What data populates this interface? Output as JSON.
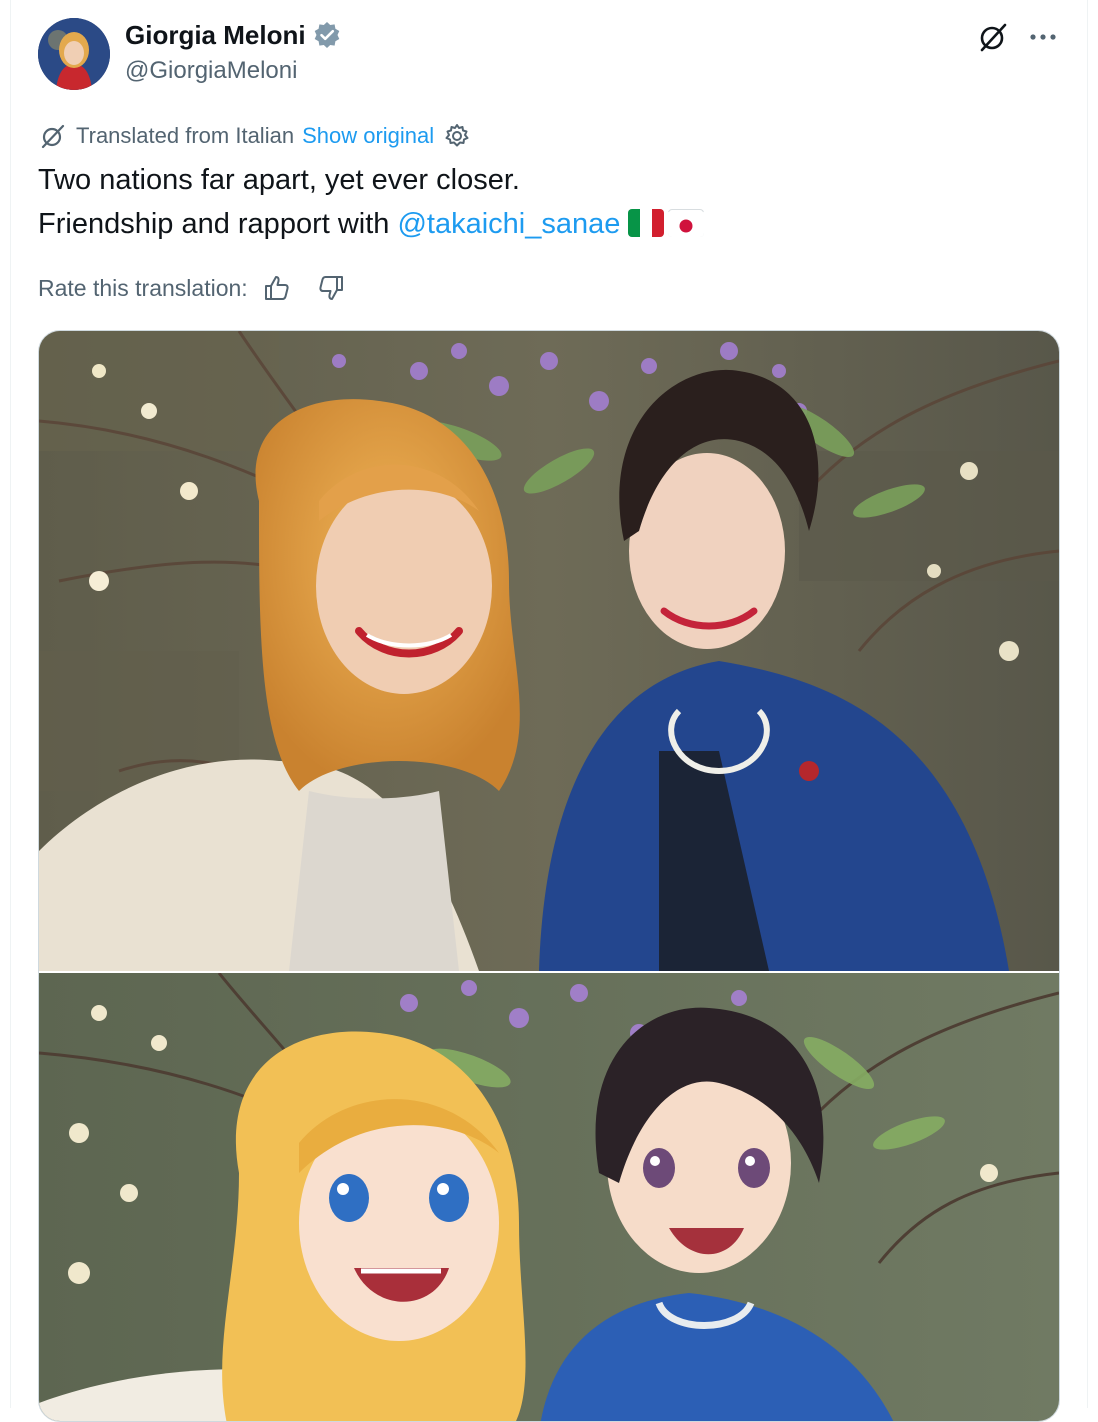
{
  "author": {
    "display_name": "Giorgia Meloni",
    "handle": "@GiorgiaMeloni",
    "verified_icon": "verified-badge-icon",
    "avatar_icon": "profile-avatar"
  },
  "header_actions": {
    "grok_icon": "grok-slash-icon",
    "more_icon": "more-dots-icon"
  },
  "translation": {
    "label": "Translated from Italian",
    "show_original": "Show original",
    "settings_icon": "gear-icon"
  },
  "tweet": {
    "line1": "Two nations far apart, yet ever closer.",
    "line2_prefix": "Friendship and rapport with ",
    "mention": "@takaichi_sanae",
    "flags": [
      "italy-flag",
      "japan-flag"
    ]
  },
  "rate": {
    "label": "Rate this translation:",
    "thumb_up": "thumbs-up-icon",
    "thumb_down": "thumbs-down-icon"
  },
  "colors": {
    "link": "#1d9bf0",
    "muted": "#536471",
    "text": "#0f1419",
    "verified": "#829aab"
  },
  "media": {
    "count": 2,
    "items": [
      "selfie-photo",
      "anime-style-illustration"
    ]
  }
}
